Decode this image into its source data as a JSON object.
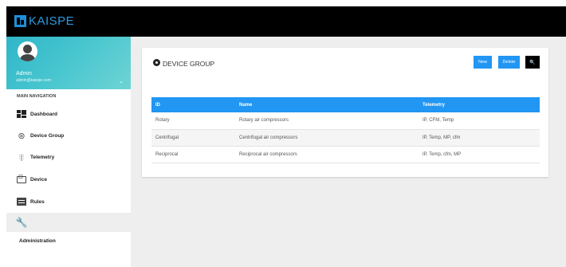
{
  "brand": {
    "name": "KAISPE"
  },
  "user": {
    "name": "Admin",
    "email": "admin@kaispe.com"
  },
  "nav": {
    "header": "MAIN NAVIGATION",
    "items": [
      {
        "label": "Dashboard",
        "icon": "dashboard-icon"
      },
      {
        "label": "Device Group",
        "icon": "device-group-icon"
      },
      {
        "label": "Telemetry",
        "icon": "telemetry-icon"
      },
      {
        "label": "Device",
        "icon": "device-icon"
      },
      {
        "label": "Rules",
        "icon": "rules-icon"
      }
    ],
    "admin_label": "Administration"
  },
  "card": {
    "title": "DEVICE GROUP",
    "buttons": {
      "new": "New",
      "delete": "Delete",
      "search": "🔍"
    }
  },
  "table": {
    "headers": [
      "ID",
      "Name",
      "Telemetry"
    ],
    "rows": [
      [
        "Rotary",
        "Rotary air compressors",
        "IP, CFM, Temp"
      ],
      [
        "Centrifugal",
        "Centrifugal air compressors",
        "IP, Temp, MP, cfm"
      ],
      [
        "Reciprocal",
        "Reciprocal air compressors",
        "IP, Temp, cfm, MP"
      ]
    ]
  },
  "colors": {
    "primary": "#2196f3",
    "header": "#000000",
    "user_panel": "#49c6cf"
  }
}
